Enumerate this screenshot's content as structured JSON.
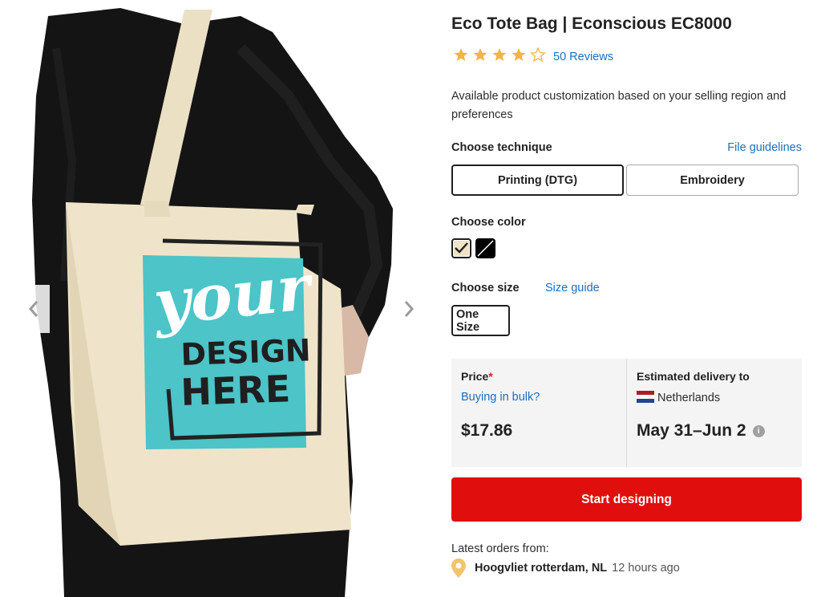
{
  "product": {
    "title": "Eco Tote Bag | Econscious EC8000",
    "rating": 4,
    "rating_max": 5,
    "reviews_label": "50 Reviews",
    "description": "Available product customization based on your selling region and preferences"
  },
  "gallery": {
    "prev_icon": "chevron-left-icon",
    "next_icon": "chevron-right-icon",
    "print_area": {
      "line1": "your",
      "line2": "DESIGN",
      "line3": "HERE",
      "fill_color": "#4cc4c8"
    }
  },
  "technique": {
    "label": "Choose technique",
    "guidelines_link": "File guidelines",
    "options": [
      "Printing (DTG)",
      "Embroidery"
    ],
    "selected": "Printing (DTG)"
  },
  "color": {
    "label": "Choose color",
    "swatches": [
      {
        "name": "oyster",
        "hex": "#efe3c6",
        "selected": true
      },
      {
        "name": "black",
        "hex": "#000000",
        "selected": false
      }
    ]
  },
  "size": {
    "label": "Choose size",
    "guide_link": "Size guide",
    "options": [
      "One Size"
    ],
    "selected": "One Size"
  },
  "pricing": {
    "price_label": "Price",
    "required_mark": "*",
    "bulk_link": "Buying in bulk?",
    "price": "$17.86"
  },
  "delivery": {
    "label": "Estimated delivery to",
    "country": "Netherlands",
    "dates": "May 31–Jun 2",
    "info_icon": "i"
  },
  "cta": {
    "label": "Start designing",
    "color": "#e10e0e"
  },
  "latest_orders": {
    "label": "Latest orders from:",
    "location": "Hoogvliet rotterdam, NL",
    "time_ago": "12 hours ago"
  },
  "colors": {
    "accent_link": "#1a6fc1",
    "star": "#f2b544"
  }
}
